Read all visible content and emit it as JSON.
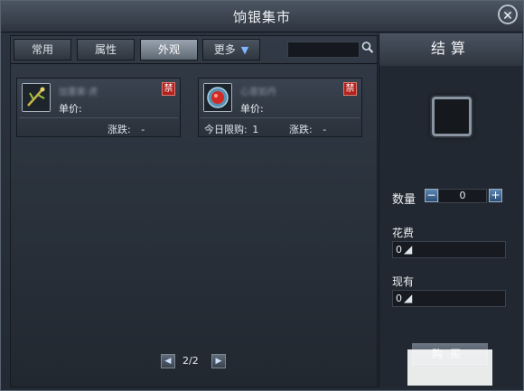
{
  "window": {
    "title": "饷银集市",
    "close_glyph": "✕"
  },
  "tabs": [
    {
      "label": "常用",
      "active": false
    },
    {
      "label": "属性",
      "active": false
    },
    {
      "label": "外观",
      "active": true
    },
    {
      "label": "更多",
      "active": false,
      "has_dropdown": true
    }
  ],
  "search": {
    "value": "",
    "icon": "search-icon"
  },
  "items": [
    {
      "name": "加重紫·虎",
      "badge": "禁",
      "unit_price_label": "单价:",
      "limit_label": "",
      "change_label": "涨跌:",
      "change_value": "-",
      "icon": "golden-branch-icon"
    },
    {
      "name": "心意如丹",
      "badge": "禁",
      "unit_price_label": "单价:",
      "limit_label": "今日限购:",
      "limit_value": "1",
      "change_label": "涨跌:",
      "change_value": "-",
      "icon": "red-orb-icon"
    }
  ],
  "pager": {
    "text": "2/2",
    "prev_icon": "◀",
    "next_icon": "▶"
  },
  "settlement": {
    "title": "结算",
    "quantity_label": "数量",
    "quantity_minus": "−",
    "quantity_value": "0",
    "quantity_plus": "+",
    "cost_label": "花费",
    "cost_value": "0",
    "owned_label": "现有",
    "owned_value": "0",
    "buy_label": "购买"
  },
  "colors": {
    "accent_blue": "#3f6fa8",
    "badge_red": "#b2211d"
  }
}
